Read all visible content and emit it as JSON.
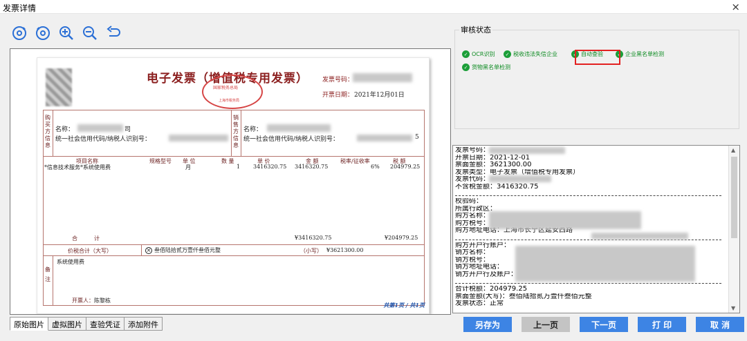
{
  "window": {
    "title": "发票详情",
    "close_glyph": "×"
  },
  "toolbar": [
    {
      "name": "rotate-right-icon"
    },
    {
      "name": "rotate-left-icon"
    },
    {
      "name": "zoom-in-icon"
    },
    {
      "name": "zoom-out-icon"
    },
    {
      "name": "undo-icon"
    }
  ],
  "invoice": {
    "title": "电子发票（增值税专用发票）",
    "seal_top": "国家税务总局",
    "seal_bottom": "上海市税务局",
    "number_label": "发票号码：",
    "date_label": "开票日期：",
    "date_value": "2021年12月01日",
    "buyer_block_label": "购买方信息",
    "seller_block_label": "销售方信息",
    "buyer_name_label": "名称：",
    "buyer_name_suffix": "司",
    "buyer_tax_label": "统一社会信用代码/纳税人识别号：",
    "seller_name_label": "名称：",
    "seller_tax_label": "统一社会信用代码/纳税人识别号：",
    "seller_tax_tail": "5",
    "item_headers": [
      "项目名称",
      "规格型号",
      "单 位",
      "数 量",
      "单 价",
      "金 额",
      "税率/征收率",
      "税 额"
    ],
    "item": {
      "name": "*信息技术服务*系统使用费",
      "unit": "月",
      "qty": "1",
      "price": "3416320.75",
      "amount": "3416320.75",
      "rate": "6%",
      "tax": "204979.25"
    },
    "total_label": "合　　　计",
    "total_amount": "¥3416320.75",
    "total_tax": "¥204979.25",
    "sum_label": "价税合计（大写）",
    "sum_upper": "叁佰陆拾贰万壹仟叁佰元整",
    "sum_lower_label": "（小写）",
    "sum_lower": "¥3621300.00",
    "remark_label": "备注",
    "remark_text": "系统使用费",
    "issuer_label": "开票人：",
    "issuer": "陈黎栋",
    "pager": "共第1页 / 共1页"
  },
  "tabs": [
    "原始图片",
    "虚拟图片",
    "查验凭证",
    "添加附件"
  ],
  "audit": {
    "legend": "审核状态",
    "chips": [
      "OCR识别",
      "税收违法失信企业",
      "自动查验",
      "企业黑名单检测",
      "货物黑名单检测"
    ]
  },
  "detail": {
    "lines": [
      "发票号码：",
      "开票日期：2021-12-01",
      "票面金额：3621300.00",
      "发票类型：电子发票（增值税专用发票）",
      "发票代码：",
      "不含税金额：3416320.75",
      "---",
      "校验码：",
      "所属行政区：",
      "购方名称：",
      "购方税号：",
      "购方地址电话：上海市长宁区延安西路",
      "---",
      "购方开户行账户：",
      "销方名称：",
      "销方税号：",
      "销方地址电话：",
      "销方开户行及账户：",
      "---",
      "合计税额：204979.25",
      "票面金额(大写)：叁佰陆拾贰万壹仟叁佰元整",
      "发票状态：正常"
    ]
  },
  "buttons": [
    {
      "label": "另存为",
      "style": "blue"
    },
    {
      "label": "上一页",
      "style": "gray"
    },
    {
      "label": "下一页",
      "style": "blue"
    },
    {
      "label": "打 印",
      "style": "blue"
    },
    {
      "label": "取 消",
      "style": "blue"
    }
  ],
  "colors": {
    "accent": "#3d84e4",
    "ok_green": "#1b9e38",
    "highlight": "#e32020",
    "invoice_red": "#8b1f1f"
  }
}
